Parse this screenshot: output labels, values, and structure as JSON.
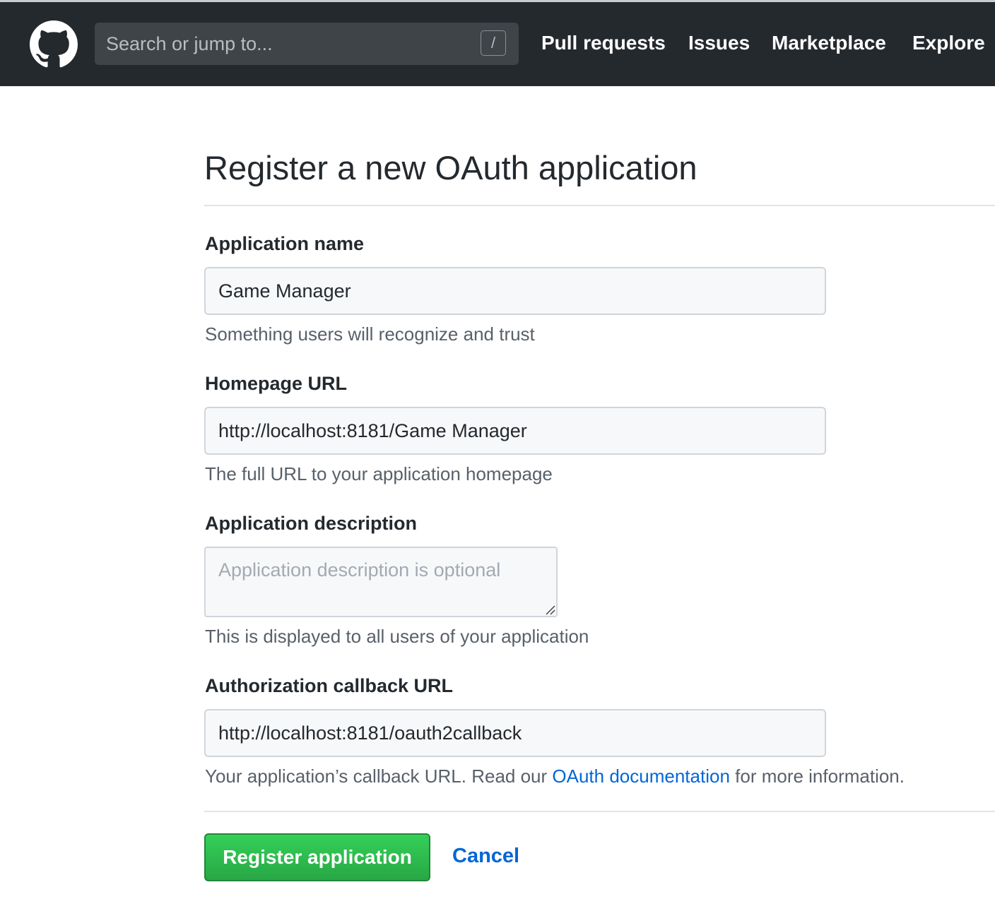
{
  "header": {
    "logo_icon": "github-octocat-icon",
    "search_placeholder": "Search or jump to...",
    "search_shortcut": "/",
    "nav": [
      {
        "label": "Pull requests"
      },
      {
        "label": "Issues"
      },
      {
        "label": "Marketplace"
      },
      {
        "label": "Explore"
      }
    ]
  },
  "form": {
    "title": "Register a new OAuth application",
    "app_name": {
      "label": "Application name",
      "value": "Game Manager",
      "note": "Something users will recognize and trust"
    },
    "homepage": {
      "label": "Homepage URL",
      "value": "http://localhost:8181/Game Manager",
      "note": "The full URL to your application homepage"
    },
    "description": {
      "label": "Application description",
      "placeholder": "Application description is optional",
      "note": "This is displayed to all users of your application"
    },
    "callback": {
      "label": "Authorization callback URL",
      "value": "http://localhost:8181/oauth2callback",
      "note_before": "Your application’s callback URL. Read our ",
      "note_link": "OAuth documentation",
      "note_after": " for more information."
    },
    "submit_label": "Register application",
    "cancel_label": "Cancel"
  },
  "colors": {
    "header_bg": "#24292e",
    "link": "#0366d6",
    "primary_button": "#28a745"
  }
}
